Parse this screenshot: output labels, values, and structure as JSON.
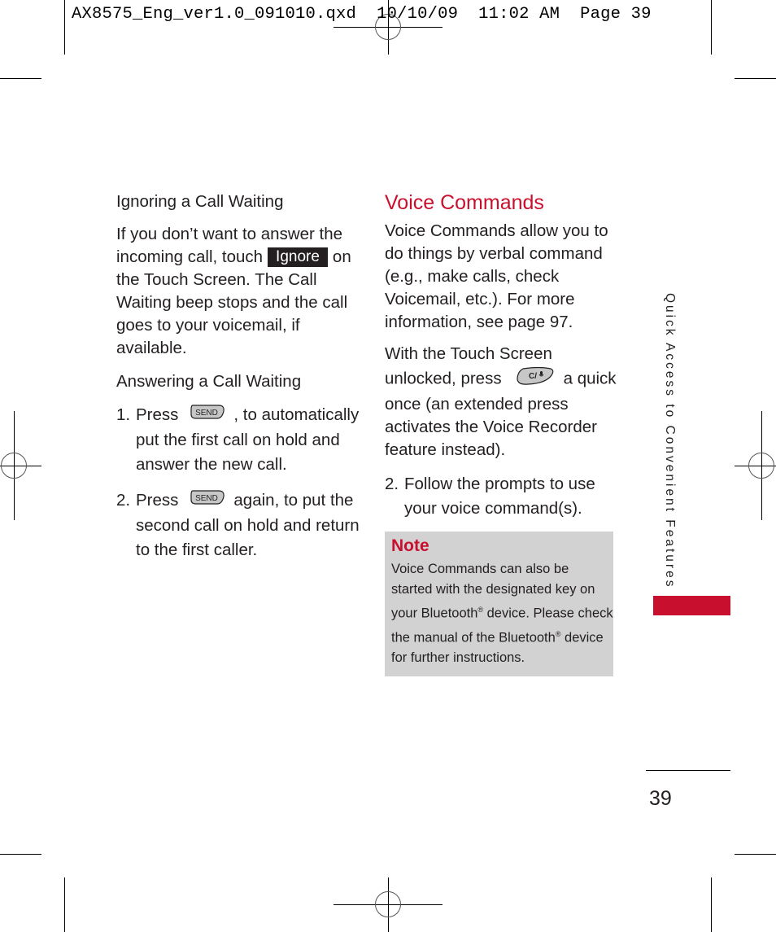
{
  "slug": {
    "filename": "AX8575_Eng_ver1.0_091010.qxd",
    "date": "10/10/09",
    "time": "11:02 AM",
    "page_label": "Page 39"
  },
  "left": {
    "ignoring": {
      "heading": "Ignoring a Call Waiting",
      "text_before": "If you don’t want to answer the incoming call, touch",
      "button_label": "Ignore",
      "text_after": "on the Touch Screen. The Call Waiting beep stops and the call goes to your voicemail, if available."
    },
    "answering": {
      "heading": "Answering a Call Waiting",
      "steps": [
        {
          "num": "1.",
          "before": "Press",
          "key": "SEND",
          "after": ", to automatically put the first call on hold and answer the new call."
        },
        {
          "num": "2.",
          "before": "Press",
          "key": "SEND",
          "after": "again, to put the second call on hold and return to the first caller."
        }
      ]
    }
  },
  "right": {
    "heading": "Voice Commands",
    "intro": "Voice Commands allow you to do things by verbal command (e.g., make calls, check Voicemail, etc.). For more information, see page 97.",
    "step1_before": "With the Touch Screen unlocked, press",
    "step1_key": "C/",
    "step1_after": "a quick once (an extended press activates the Voice Recorder feature instead).",
    "step2_num": "2.",
    "step2_text": "Follow the prompts to use your voice command(s).",
    "note": {
      "title": "Note",
      "line1": "Voice Commands can also be started with the designated key on your Bluetooth",
      "reg1": "®",
      "line2": " device. Please check the manual of the Bluetooth",
      "reg2": "®",
      "line3": " device for further instructions."
    }
  },
  "side_tab": {
    "label": "Quick Access to Convenient Features",
    "accent_color": "#c8102e"
  },
  "page_number": "39",
  "colors": {
    "accent": "#c8102e",
    "note_bg": "#d2d2d2",
    "text": "#231f20"
  }
}
